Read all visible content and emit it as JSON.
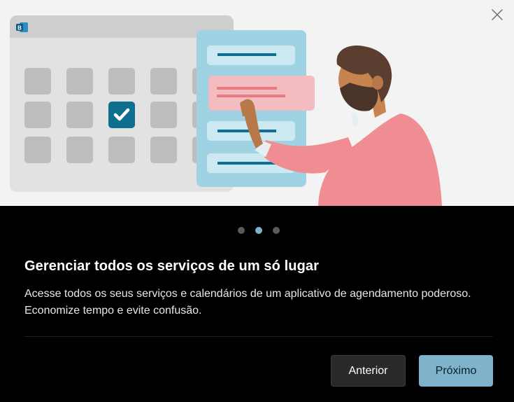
{
  "dialog": {
    "title": "Gerenciar todos os serviços de um só lugar",
    "description": "Acesse todos os seus serviços e calendários de um aplicativo de agendamento poderoso. Economize tempo e evite confusão.",
    "close_icon": "close-icon",
    "app_badge": "B",
    "pagination": {
      "total": 3,
      "current": 2
    },
    "buttons": {
      "previous_label": "Anterior",
      "next_label": "Próximo"
    },
    "colors": {
      "accent": "#7fb3cc",
      "background": "#000000",
      "hero_background": "#f4f3f3"
    }
  }
}
